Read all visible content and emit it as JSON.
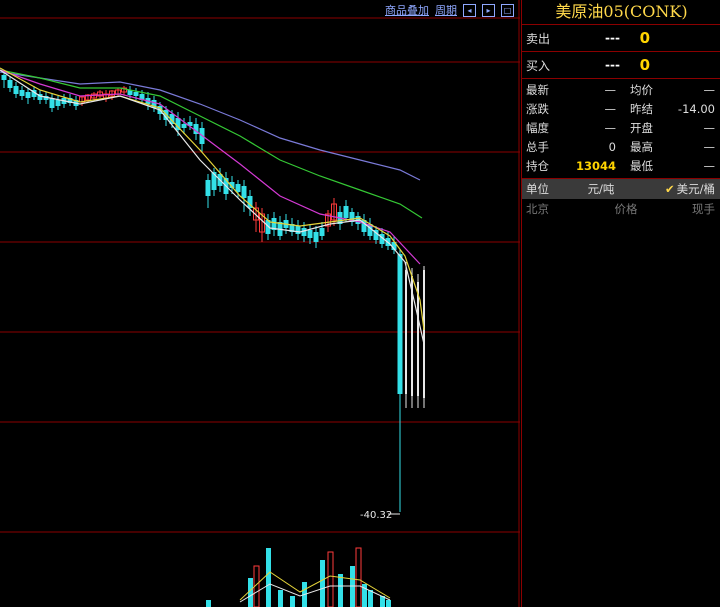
{
  "toolbar": {
    "overlay_label": "商品叠加",
    "period_label": "周期"
  },
  "chart": {
    "min_label": "-40.32"
  },
  "quote": {
    "title": "美原油05(CONK)",
    "sell_label": "卖出",
    "sell_price": "---",
    "sell_volume": "0",
    "buy_label": "买入",
    "buy_price": "---",
    "buy_volume": "0",
    "rows": [
      {
        "k1": "最新",
        "v1": "—",
        "k2": "均价",
        "v2": "—"
      },
      {
        "k1": "涨跌",
        "v1": "—",
        "k2": "昨结",
        "v2": "-14.00"
      },
      {
        "k1": "幅度",
        "v1": "—",
        "k2": "开盘",
        "v2": "—"
      },
      {
        "k1": "总手",
        "v1": "0",
        "k2": "最高",
        "v2": "—"
      },
      {
        "k1": "持仓",
        "v1": "13044",
        "k2": "最低",
        "v2": "—"
      }
    ],
    "unit_label": "单位",
    "unit_opt1": "元/吨",
    "unit_opt2": "美元/桶",
    "hdr_market": "北京",
    "hdr_price": "价格",
    "hdr_current": "现手"
  },
  "colors": {
    "up_candle": "#ff3b3b",
    "down_candle": "#33e0e8",
    "ma_white": "#e8e8e8",
    "ma_yellow": "#e5d43a",
    "ma_magenta": "#d43ad4",
    "ma_green": "#35c835",
    "ma_blue": "#7a7ad8",
    "grid": "#8b0000",
    "title": "#ffd84a"
  }
}
